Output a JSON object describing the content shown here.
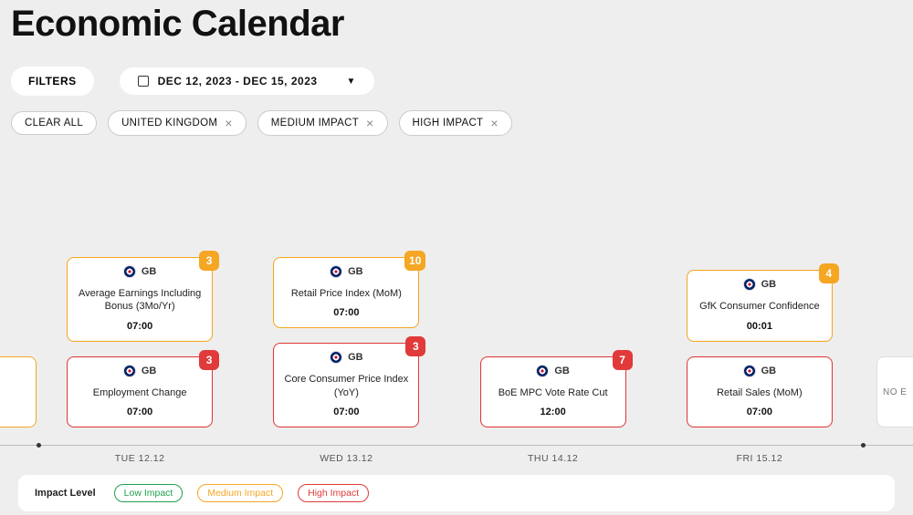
{
  "header": {
    "title": "Economic Calendar"
  },
  "controls": {
    "filters_label": "FILTERS",
    "date_range_label": "DEC 12, 2023 - DEC 15, 2023"
  },
  "chips": {
    "clear_all": "CLEAR ALL",
    "items": [
      {
        "label": "UNITED KINGDOM"
      },
      {
        "label": "MEDIUM IMPACT"
      },
      {
        "label": "HIGH IMPACT"
      }
    ]
  },
  "columns": [
    {
      "axis_label": "TUE 12.12",
      "events": [
        {
          "impact": "medium",
          "badge": "3",
          "country": "GB",
          "title": "Average Earnings Including Bonus (3Mo/Yr)",
          "time": "07:00"
        },
        {
          "impact": "high",
          "badge": "3",
          "country": "GB",
          "title": "Employment Change",
          "time": "07:00"
        }
      ]
    },
    {
      "axis_label": "WED 13.12",
      "events": [
        {
          "impact": "medium",
          "badge": "10",
          "country": "GB",
          "title": "Retail Price Index (MoM)",
          "time": "07:00"
        },
        {
          "impact": "high",
          "badge": "3",
          "country": "GB",
          "title": "Core Consumer Price Index (YoY)",
          "time": "07:00"
        }
      ]
    },
    {
      "axis_label": "THU 14.12",
      "events": [
        {
          "impact": "high",
          "badge": "7",
          "country": "GB",
          "title": "BoE MPC Vote Rate Cut",
          "time": "12:00"
        }
      ]
    },
    {
      "axis_label": "FRI 15.12",
      "events": [
        {
          "impact": "medium",
          "badge": "4",
          "country": "GB",
          "title": "GfK Consumer Confidence",
          "time": "00:01"
        },
        {
          "impact": "high",
          "badge": "",
          "country": "GB",
          "title": "Retail Sales (MoM)",
          "time": "07:00"
        }
      ]
    }
  ],
  "ghost_right_label": "NO E",
  "legend": {
    "label": "Impact Level",
    "low": "Low Impact",
    "medium": "Medium Impact",
    "high": "High Impact"
  }
}
